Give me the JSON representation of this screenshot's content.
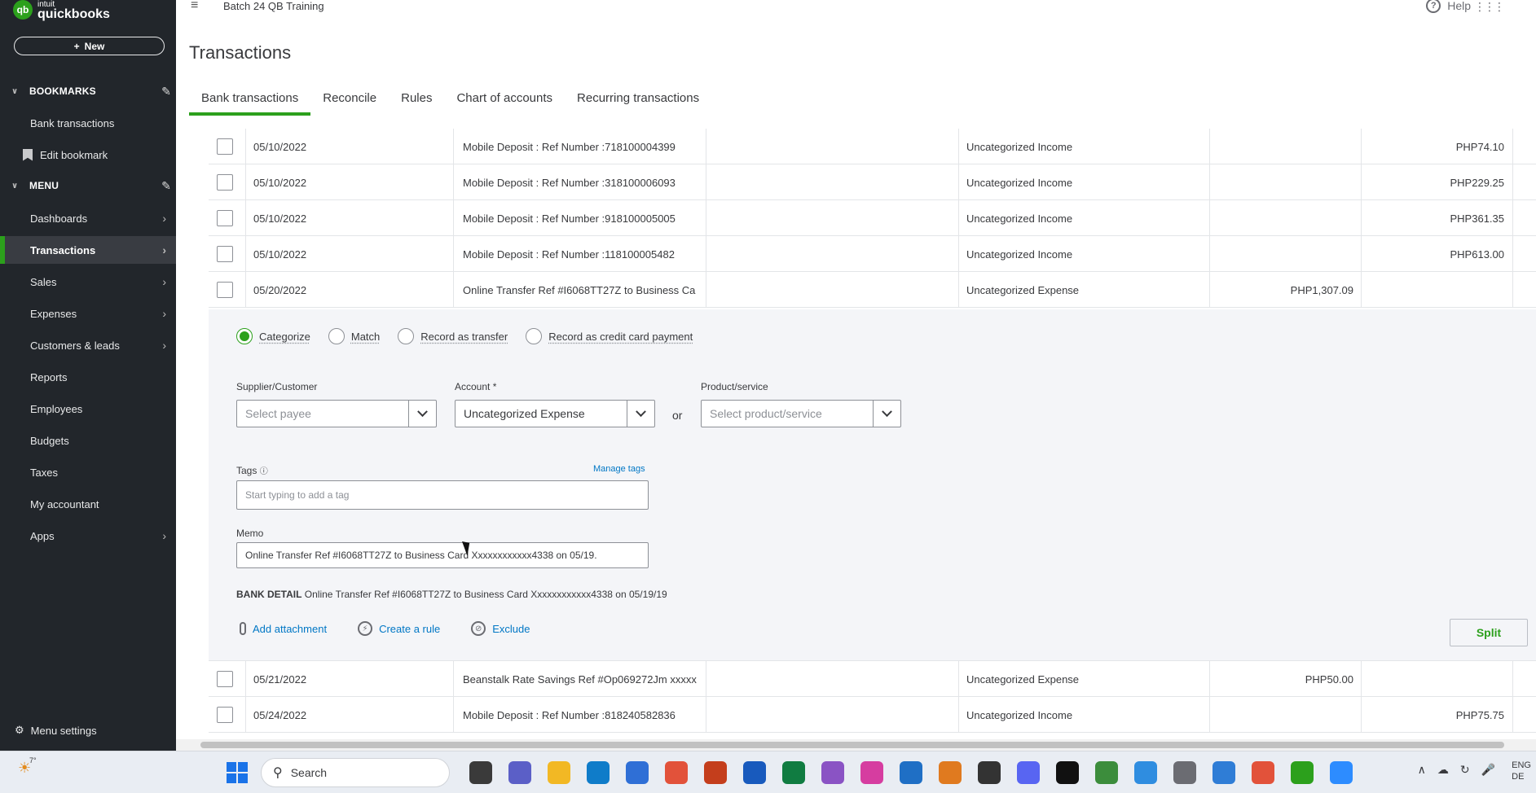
{
  "app": {
    "logo_line1": "intuit",
    "logo_line2": "quickbooks",
    "company": "Batch 24 QB Training",
    "help": "Help",
    "page_title": "Transactions"
  },
  "sidebar": {
    "new_label": "New",
    "bookmarks_header": "BOOKMARKS",
    "bookmarks": [
      "Bank transactions",
      "Edit bookmark"
    ],
    "menu_header": "MENU",
    "items": [
      {
        "label": "Dashboards",
        "arrow": true
      },
      {
        "label": "Transactions",
        "arrow": true,
        "active": true
      },
      {
        "label": "Sales",
        "arrow": true
      },
      {
        "label": "Expenses",
        "arrow": true
      },
      {
        "label": "Customers & leads",
        "arrow": true
      },
      {
        "label": "Reports",
        "arrow": false
      },
      {
        "label": "Employees",
        "arrow": false
      },
      {
        "label": "Budgets",
        "arrow": false
      },
      {
        "label": "Taxes",
        "arrow": false
      },
      {
        "label": "My accountant",
        "arrow": false
      },
      {
        "label": "Apps",
        "arrow": true
      }
    ],
    "menu_settings": "Menu settings"
  },
  "tabs": [
    "Bank transactions",
    "Reconcile",
    "Rules",
    "Chart of accounts",
    "Recurring transactions"
  ],
  "rows_top": [
    {
      "date": "05/10/2022",
      "description": "Mobile Deposit : Ref Number :718100004399",
      "category": "Uncategorized Income",
      "spent": "",
      "received": "PHP74.10"
    },
    {
      "date": "05/10/2022",
      "description": "Mobile Deposit : Ref Number :318100006093",
      "category": "Uncategorized Income",
      "spent": "",
      "received": "PHP229.25"
    },
    {
      "date": "05/10/2022",
      "description": "Mobile Deposit : Ref Number :918100005005",
      "category": "Uncategorized Income",
      "spent": "",
      "received": "PHP361.35"
    },
    {
      "date": "05/10/2022",
      "description": "Mobile Deposit : Ref Number :118100005482",
      "category": "Uncategorized Income",
      "spent": "",
      "received": "PHP613.00"
    },
    {
      "date": "05/20/2022",
      "description": "Online Transfer Ref #I6068TT27Z to Business Ca",
      "category": "Uncategorized Expense",
      "spent": "PHP1,307.09",
      "received": ""
    }
  ],
  "rows_bottom": [
    {
      "date": "05/21/2022",
      "description": "Beanstalk Rate Savings Ref #Op069272Jm xxxxx",
      "category": "Uncategorized Expense",
      "spent": "PHP50.00",
      "received": ""
    },
    {
      "date": "05/24/2022",
      "description": "Mobile Deposit : Ref Number :818240582836",
      "category": "Uncategorized Income",
      "spent": "",
      "received": "PHP75.75"
    }
  ],
  "panel": {
    "radios": [
      "Categorize",
      "Match",
      "Record as transfer",
      "Record as credit card payment"
    ],
    "supplier_label": "Supplier/Customer",
    "supplier_placeholder": "Select payee",
    "account_label": "Account *",
    "account_value": "Uncategorized Expense",
    "or": "or",
    "product_label": "Product/service",
    "product_placeholder": "Select product/service",
    "tags_label": "Tags",
    "manage_tags": "Manage tags",
    "tags_placeholder": "Start typing to add a tag",
    "memo_label": "Memo",
    "memo_value": "Online Transfer Ref #I6068TT27Z to Business Card Xxxxxxxxxxxx4338 on 05/19.",
    "bank_detail_label": "BANK DETAIL",
    "bank_detail_value": "Online Transfer Ref #I6068TT27Z to Business Card Xxxxxxxxxxxx4338 on 05/19/19",
    "add_attachment": "Add attachment",
    "create_rule": "Create a rule",
    "exclude": "Exclude",
    "split": "Split"
  },
  "taskbar": {
    "weather": "7°",
    "search": "Search",
    "tray_line1": "ENG",
    "tray_line2": "DE"
  }
}
